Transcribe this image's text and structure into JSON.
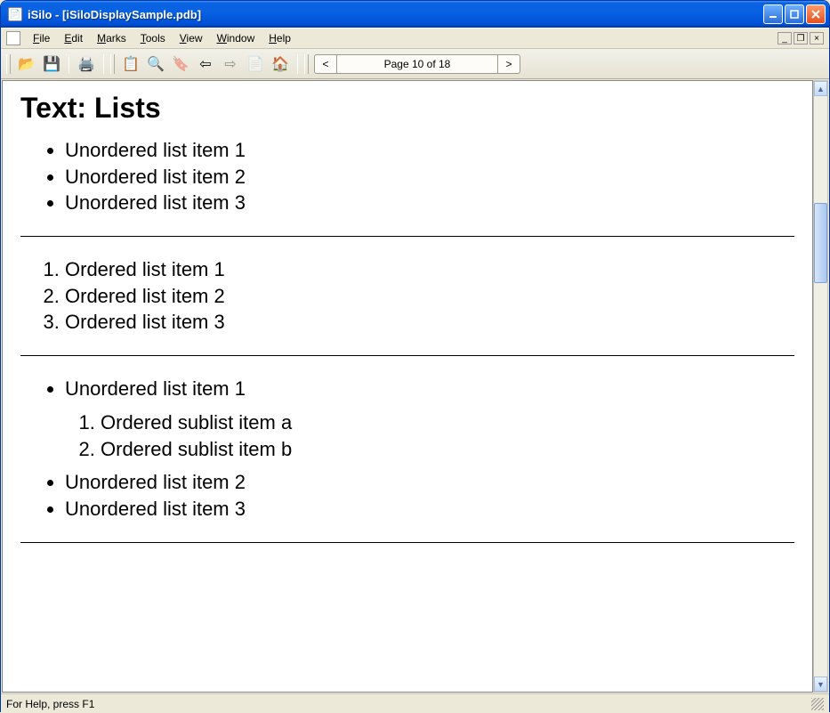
{
  "window": {
    "title": "iSilo - [iSiloDisplaySample.pdb]"
  },
  "menu": {
    "file": "File",
    "edit": "Edit",
    "marks": "Marks",
    "tools": "Tools",
    "view": "View",
    "window": "Window",
    "help": "Help"
  },
  "toolbar": {
    "page_display": "Page 10 of 18"
  },
  "content": {
    "heading": "Text: Lists",
    "ul1": {
      "i1": "Unordered list item 1",
      "i2": "Unordered list item 2",
      "i3": "Unordered list item 3"
    },
    "ol1": {
      "i1": "Ordered list item 1",
      "i2": "Ordered list item 2",
      "i3": "Ordered list item 3"
    },
    "nested": {
      "u1": "Unordered list item 1",
      "suba": "Ordered sublist item a",
      "subb": "Ordered sublist item b",
      "u2": "Unordered list item 2",
      "u3": "Unordered list item 3"
    }
  },
  "statusbar": {
    "text": "For Help, press F1"
  }
}
